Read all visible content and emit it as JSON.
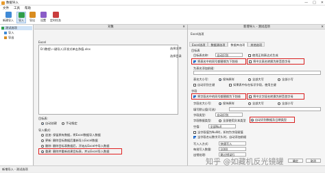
{
  "window": {
    "title": "数据导入",
    "controls": [
      "—",
      "□",
      "✕"
    ]
  },
  "menu": [
    "文件",
    "工具",
    "帮助"
  ],
  "toolbar": [
    {
      "label": "新建导入",
      "color": "#3f8ad6"
    },
    {
      "label": "导入",
      "color": "#2f9e4a"
    },
    {
      "label": "导出",
      "color": "#d98c1f"
    },
    {
      "label": "设置",
      "color": "#8a5cc7"
    },
    {
      "label": "定时任务",
      "color": "#c93d3d"
    }
  ],
  "nav": {
    "items": [
      {
        "label": "测试选项",
        "selected": true
      },
      {
        "label": "导入",
        "selected": false
      },
      {
        "label": "导出",
        "selected": false
      }
    ]
  },
  "main": {
    "header": "对象",
    "source_label": "Excel",
    "source_path": "D:\\教程\\一键导入\\开发式单击净值.xlsx",
    "select_file": "选择文件",
    "select_dir": "选择目录",
    "target_label": "目标表:",
    "target_options": [
      "自动创建",
      "手动指定"
    ],
    "mode_label": "导入模式:",
    "modes": [
      {
        "label": "追加: 保留原有数据，将Excel数据导入数据",
        "selected": false
      },
      {
        "label": "更新: 删除目标数据后重新导入Excel数据",
        "selected": false
      },
      {
        "label": "删除: 删除目标表数据后，开始从Excel中导入数据",
        "selected": false
      },
      {
        "label": "重建: 删除并重新创建目标表，并从Excel导入数据",
        "selected": true
      }
    ]
  },
  "dialog": {
    "title": "新增导入 - 测试选项",
    "section": "Excel选项",
    "tabs": [
      "Excel选项",
      "数据源选项",
      "数据库选项",
      "其他选项"
    ],
    "active_tab": 2,
    "table_label": "目标表",
    "table_name_label": "目标表名称:",
    "table_name_value": "自动识别",
    "table_name_hint": "使用正则表达式生成",
    "opts_a": [
      {
        "label": "将表名中的同号都替换为下划线",
        "checked": true
      },
      {
        "label": "将中文表名转换为拼音首字母",
        "checked": false
      }
    ],
    "prefix_label": "为表名添加前缀:",
    "prefix_value": "",
    "case_label": "表名大小写:",
    "case_opts": [
      "保持原样",
      "全部大写",
      "全部小写"
    ],
    "opt_b_label": "自动识别主键",
    "opt_b2_label": "如果表中存在标识字段，使用主键",
    "field_label": "字段",
    "opts_c": [
      {
        "label": "将字段名中的同号都替换为下划线",
        "checked": true
      },
      {
        "label": "将中文字段名转换为拼音首字母",
        "checked": false
      }
    ],
    "field_case_label": "字段名大小写:",
    "field_case_opts": [
      "保持原样",
      "全部大写",
      "全部小写"
    ],
    "field_kv_label": "填写默认值(可选)",
    "type_label": "字段类型:",
    "type_value": "自动识别",
    "text_label": "字段数据类型:",
    "text_opts": [
      {
        "label": "全部使用文本类型",
        "selected": false
      },
      {
        "label": "自动识别数据及日期类型",
        "selected": true
      }
    ],
    "null_label": "空值:",
    "null_value": "全部Null",
    "opts_d": [
      {
        "label": "当字段值为Null时，如何为字段赋值",
        "checked": false
      },
      {
        "label": "当字段名以数字开头时，自动添加前缀",
        "checked": true
      }
    ],
    "write_label": "写入入方式:",
    "write_value": "快速写入",
    "batch_label": "每批写入数量:",
    "batch_value": "1000",
    "err_label": "出错处理:",
    "err_value": "跳过错误行",
    "confirm": "确定",
    "cancel": "取消"
  },
  "status": "新增导入 - 测试选项",
  "watermark": "知乎 @如藏机反光镜罐"
}
